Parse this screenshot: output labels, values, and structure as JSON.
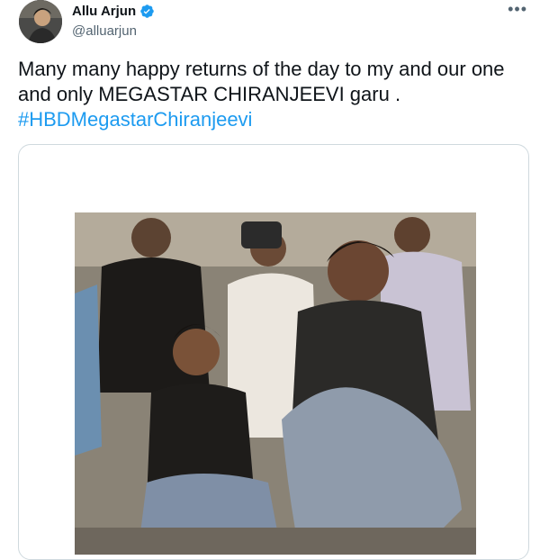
{
  "author": {
    "display_name": "Allu Arjun",
    "handle": "@alluarjun",
    "verified": true
  },
  "more_menu_label": "•••",
  "tweet": {
    "text_main": "Many many happy returns of the day to my and our one and only MEGASTAR CHIRANJEEVI garu .",
    "hashtag": "#HBDMegastarChiranjeevi"
  },
  "colors": {
    "link": "#1d9bf0",
    "text": "#0f1419",
    "secondary_text": "#536471",
    "border": "#cfd9de"
  },
  "icons": [
    "avatar",
    "verified-badge-icon",
    "more-options-icon"
  ]
}
